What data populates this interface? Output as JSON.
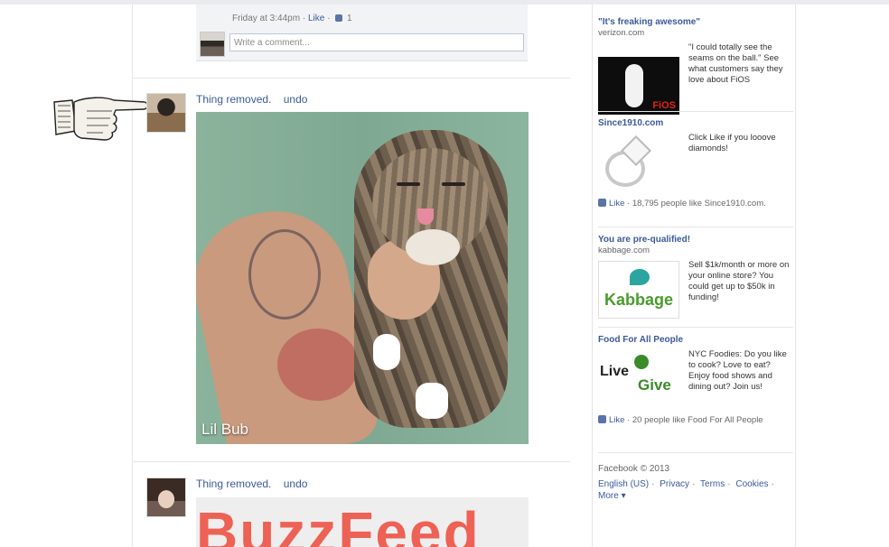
{
  "comment": {
    "meta_time": "Friday at 3:44pm",
    "meta_like": "Like",
    "meta_count": "1",
    "input_placeholder": "Write a comment..."
  },
  "posts": [
    {
      "status": "Thing removed.",
      "undo": "undo",
      "photo_caption": "Lil Bub"
    },
    {
      "status": "Thing removed.",
      "undo": "undo",
      "banner_text": "BuzzFeed"
    }
  ],
  "ads": [
    {
      "title": "\"It's freaking awesome\"",
      "domain": "verizon.com",
      "text": "\"I could totally see the seams on the ball.\" See what customers say they love about FiOS",
      "image_logo": "FiOS"
    },
    {
      "title": "Since1910.com",
      "text": "Click Like if you looove diamonds!",
      "like_label": "Like",
      "like_count": "18,795 people like Since1910.com."
    },
    {
      "title": "You are pre-qualified!",
      "domain": "kabbage.com",
      "text": "Sell $1k/month or more on your online store? You could get up to $50k in funding!",
      "image_logo": "Kabbage"
    },
    {
      "title": "Food For All People",
      "text": "NYC Foodies: Do you like to cook? Love to eat? Enjoy food shows and dining out? Join us!",
      "image_live": "Live",
      "image_give": "Give",
      "like_label": "Like",
      "like_count": "20 people like Food For All People"
    }
  ],
  "footer": {
    "copyright": "Facebook © 2013",
    "links": [
      "English (US)",
      "Privacy",
      "Terms",
      "Cookies"
    ],
    "more": "More"
  },
  "colors": {
    "link": "#3b5998",
    "background": "#ffffff"
  }
}
